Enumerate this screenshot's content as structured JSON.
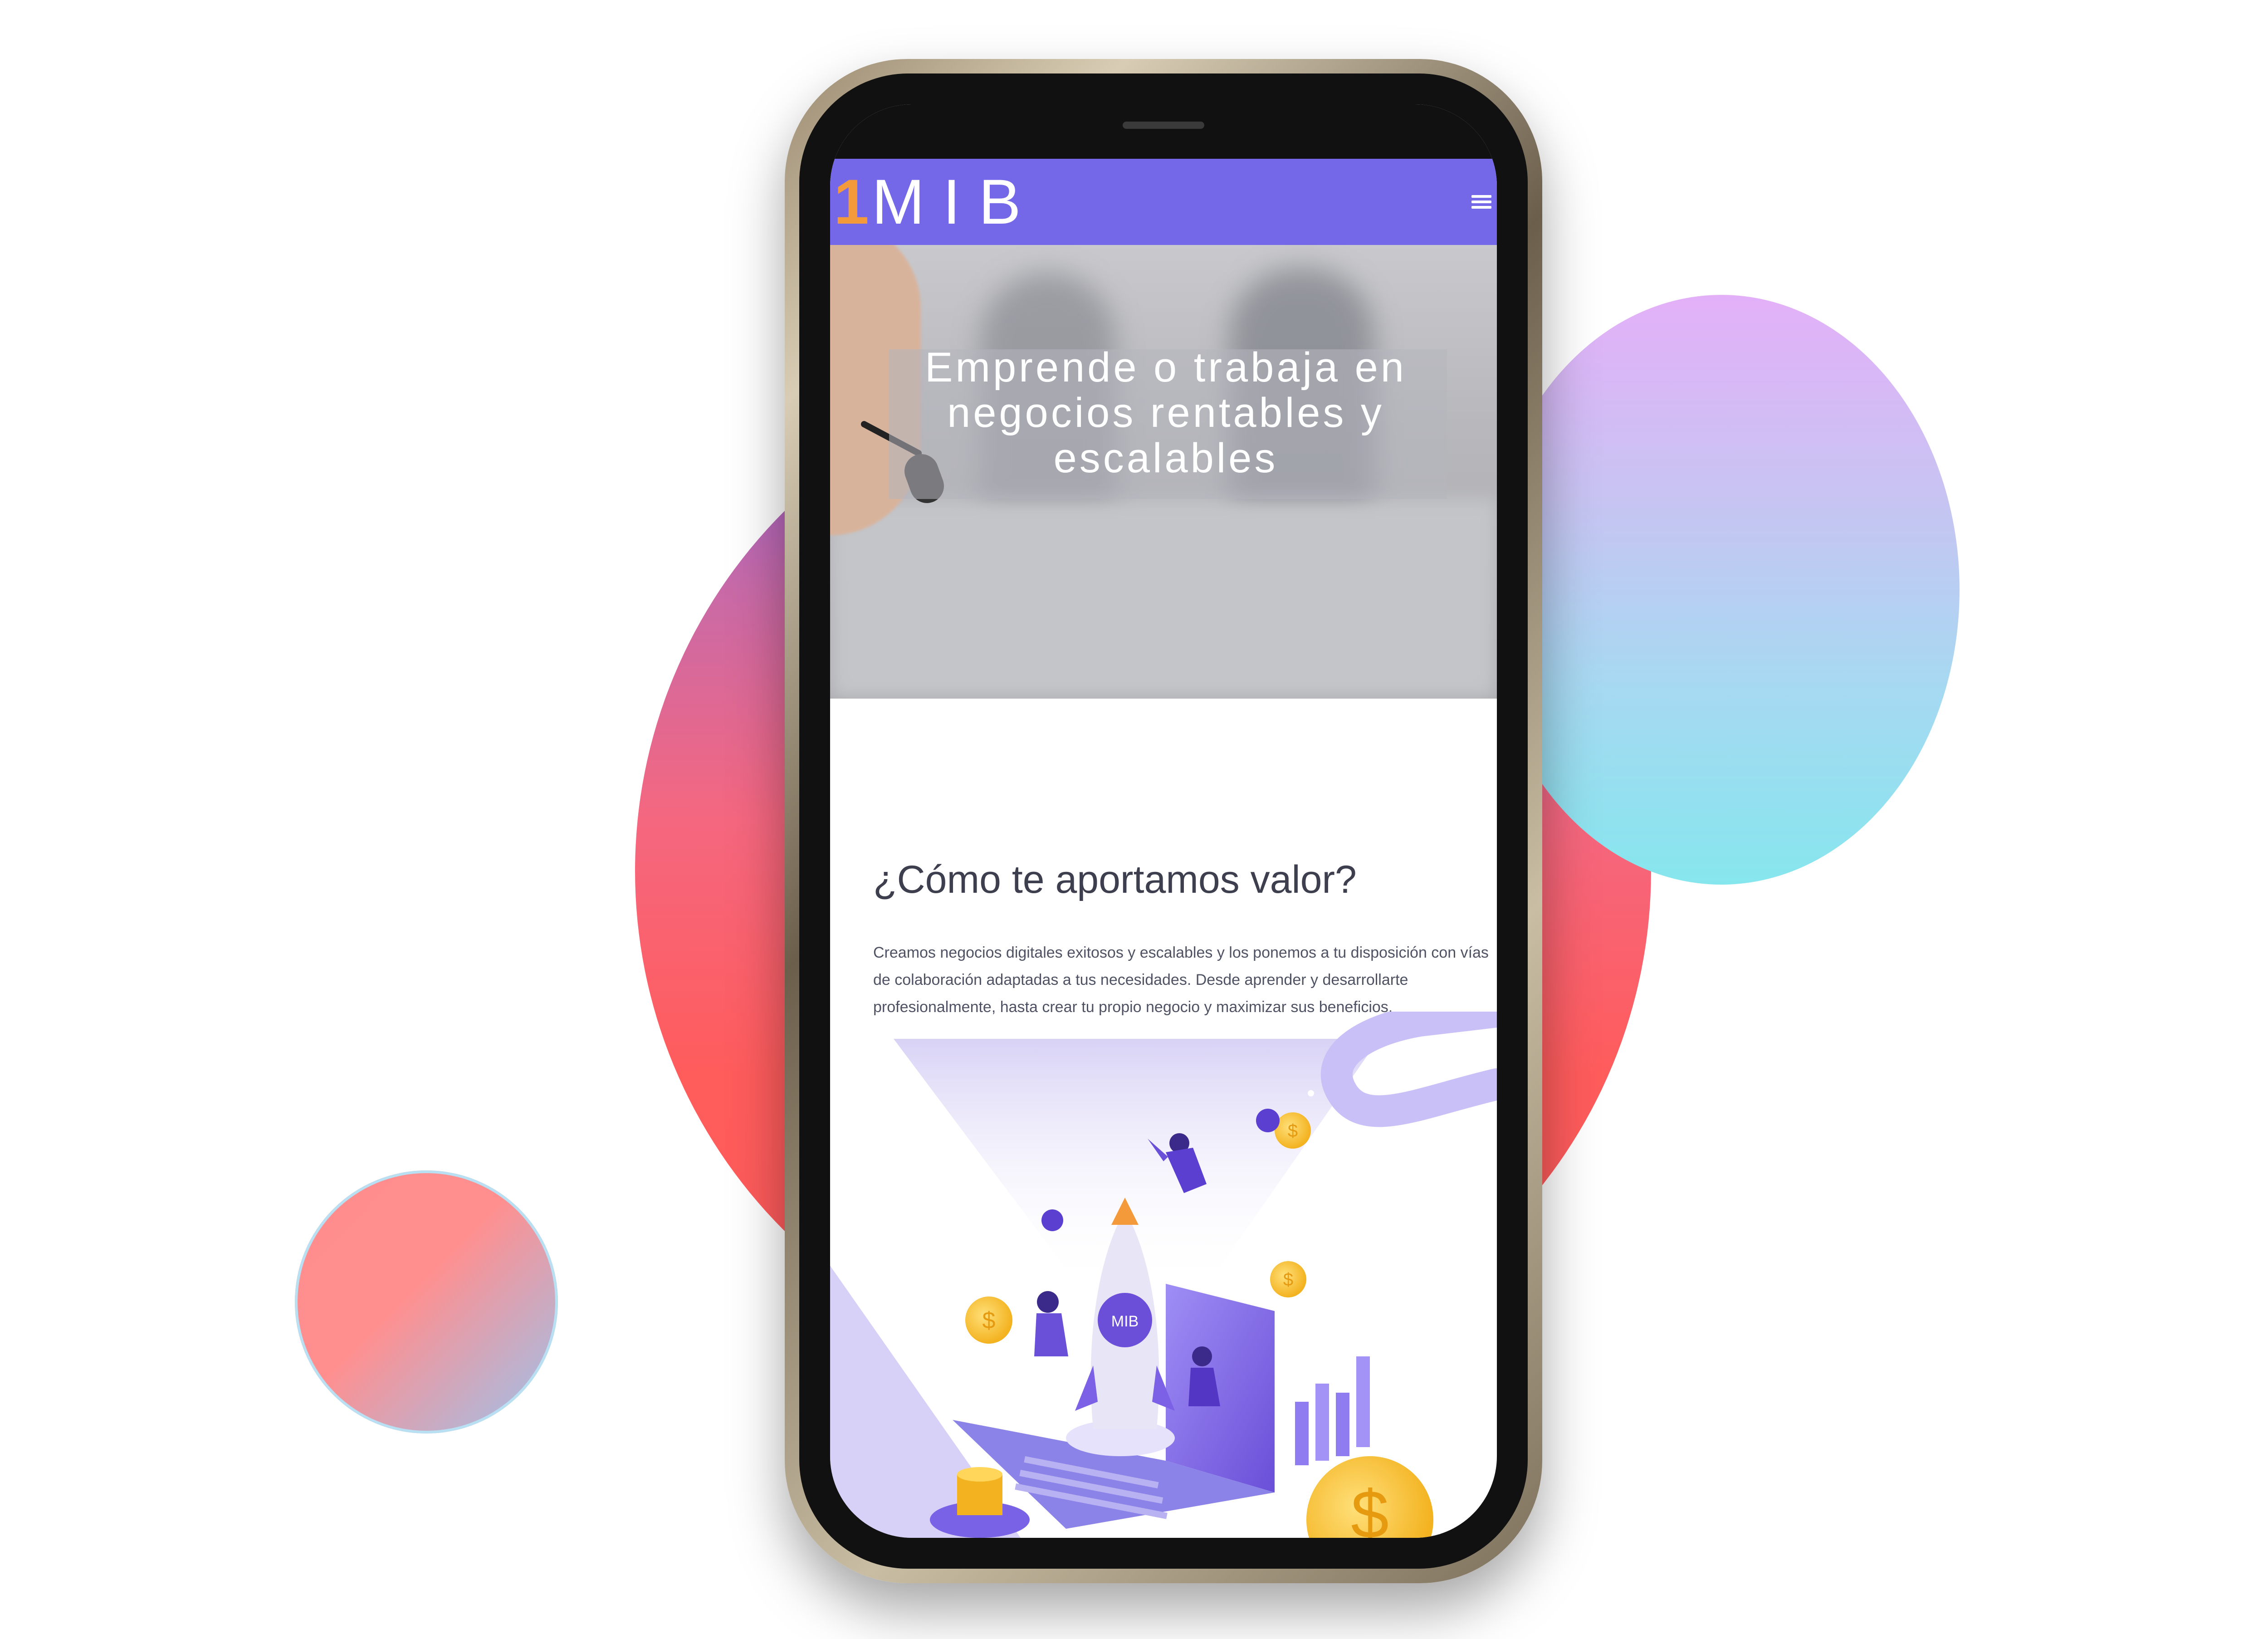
{
  "brand": {
    "logo_prefix": "1",
    "logo_text": "MIB"
  },
  "hero": {
    "title": "Emprende o trabaja en negocios rentables y escalables"
  },
  "section": {
    "title": "¿Cómo te aportamos valor?",
    "text": "Creamos negocios digitales exitosos y escalables y los ponemos a tu disposición con vías de colaboración adaptadas a tus necesidades. Desde aprender y desarrollarte profesionalmente, hasta crear tu propio negocio y maximizar sus beneficios."
  },
  "illustration": {
    "rocket_label": "MIB"
  },
  "icons": {
    "menu": "hamburger-menu-icon",
    "coin": "dollar-coin-icon"
  },
  "colors": {
    "header": "#7468e8",
    "accent_orange": "#f59a3a",
    "title_text": "#3d3f4e",
    "body_text": "#4e5262",
    "circle_red": "#ff5c5c",
    "circle_purple": "#8f64e0",
    "circle_cyan": "#86e6ee"
  }
}
